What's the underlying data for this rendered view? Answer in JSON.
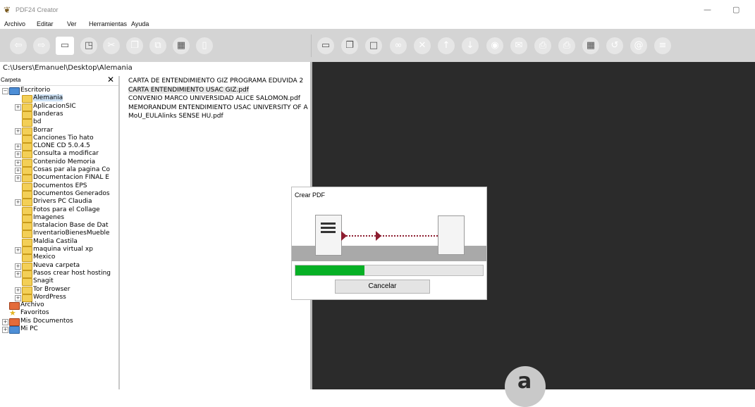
{
  "window": {
    "title": "PDF24 Creator",
    "minimize_glyph": "—",
    "restore_glyph": "▢",
    "app_icon": "app-logo-icon"
  },
  "menu": [
    "Archivo",
    "Editar",
    "Ver",
    "Herramientas",
    "Ayuda"
  ],
  "toolbar": {
    "left_icons": [
      "back-icon",
      "forward-icon",
      "open-folder-icon",
      "select-icon",
      "cut-icon",
      "copy-icon",
      "paste-icon",
      "calculator-icon",
      "trash-icon"
    ],
    "right_icons": [
      "save-icon",
      "duplicate-icon",
      "frame-icon",
      "link-icon",
      "cancel-icon",
      "move-up-icon",
      "move-down-icon",
      "view-icon",
      "mail-icon",
      "print-icon",
      "print-alt-icon",
      "calc-icon",
      "rotate-icon",
      "settings-icon",
      "list-icon"
    ]
  },
  "path": "C:\\Users\\Emanuel\\Desktop\\Alemania",
  "folder_panel": {
    "title": "Carpeta",
    "close_glyph": "✕",
    "items": [
      {
        "label": "Escritorio",
        "level": 0,
        "expander": "−",
        "icon": "desktop-icon"
      },
      {
        "label": "Alemania",
        "level": 1,
        "expander": "",
        "icon": "folder-icon",
        "selected": true
      },
      {
        "label": "AplicacionSIC",
        "level": 1,
        "expander": "+",
        "icon": "folder-icon"
      },
      {
        "label": "Banderas",
        "level": 1,
        "expander": "",
        "icon": "folder-icon"
      },
      {
        "label": "bd",
        "level": 1,
        "expander": "",
        "icon": "folder-icon"
      },
      {
        "label": "Borrar",
        "level": 1,
        "expander": "+",
        "icon": "folder-icon"
      },
      {
        "label": "Canciones Tio hato",
        "level": 1,
        "expander": "",
        "icon": "folder-icon"
      },
      {
        "label": "CLONE CD 5.0.4.5",
        "level": 1,
        "expander": "+",
        "icon": "folder-icon"
      },
      {
        "label": "Consulta a modificar",
        "level": 1,
        "expander": "+",
        "icon": "folder-icon"
      },
      {
        "label": "Contenido Memoria",
        "level": 1,
        "expander": "+",
        "icon": "folder-icon"
      },
      {
        "label": "Cosas par ala pagina Co",
        "level": 1,
        "expander": "+",
        "icon": "folder-icon"
      },
      {
        "label": "Documentacion FINAL E",
        "level": 1,
        "expander": "+",
        "icon": "folder-icon"
      },
      {
        "label": "Documentos EPS",
        "level": 1,
        "expander": "",
        "icon": "folder-icon"
      },
      {
        "label": "Documentos Generados",
        "level": 1,
        "expander": "",
        "icon": "folder-icon"
      },
      {
        "label": "Drivers PC Claudia",
        "level": 1,
        "expander": "+",
        "icon": "folder-icon"
      },
      {
        "label": "Fotos para el Collage",
        "level": 1,
        "expander": "",
        "icon": "folder-icon"
      },
      {
        "label": "Imagenes",
        "level": 1,
        "expander": "",
        "icon": "folder-icon"
      },
      {
        "label": "Instalacion Base de Dat",
        "level": 1,
        "expander": "",
        "icon": "folder-icon"
      },
      {
        "label": "InventarioBienesMueble",
        "level": 1,
        "expander": "",
        "icon": "folder-icon"
      },
      {
        "label": "Maldia Castila",
        "level": 1,
        "expander": "",
        "icon": "folder-icon"
      },
      {
        "label": "maquina virtual xp",
        "level": 1,
        "expander": "+",
        "icon": "folder-icon"
      },
      {
        "label": "Mexico",
        "level": 1,
        "expander": "",
        "icon": "folder-icon"
      },
      {
        "label": "Nueva carpeta",
        "level": 1,
        "expander": "+",
        "icon": "folder-icon"
      },
      {
        "label": "Pasos crear host hosting",
        "level": 1,
        "expander": "+",
        "icon": "folder-icon"
      },
      {
        "label": "Snagit",
        "level": 1,
        "expander": "",
        "icon": "folder-icon"
      },
      {
        "label": "Tor Browser",
        "level": 1,
        "expander": "+",
        "icon": "folder-icon"
      },
      {
        "label": "WordPress",
        "level": 1,
        "expander": "+",
        "icon": "folder-icon"
      },
      {
        "label": "Archivo",
        "level": 0,
        "expander": "",
        "icon": "archive-folder-icon"
      },
      {
        "label": "Favoritos",
        "level": 0,
        "expander": "",
        "icon": "star-icon"
      },
      {
        "label": "Mis Documentos",
        "level": 0,
        "expander": "+",
        "icon": "documents-folder-icon"
      },
      {
        "label": "Mi PC",
        "level": 0,
        "expander": "+",
        "icon": "computer-icon"
      }
    ]
  },
  "files": [
    {
      "name": "CARTA DE ENTENDIMIENTO GIZ PROGRAMA EDUVIDA 2",
      "selected": false
    },
    {
      "name": "CARTA ENTENDIMIENTO USAC GIZ.pdf",
      "selected": true
    },
    {
      "name": "CONVENIO MARCO UNIVERSIDAD ALICE SALOMON.pdf",
      "selected": false
    },
    {
      "name": "MEMORANDUM ENTENDIMIENTO USAC UNIVERSITY OF A",
      "selected": false
    },
    {
      "name": "MoU_EULAlinks SENSE HU.pdf",
      "selected": false
    }
  ],
  "dialog": {
    "title": "Crear PDF",
    "progress": 0.37,
    "progress_color": "#06b025",
    "cancel_label": "Cancelar"
  },
  "colors": {
    "toolbar_bg": "#d4d4d4",
    "preview_bg": "#2b2b2b",
    "arrow": "#8d1d30"
  }
}
